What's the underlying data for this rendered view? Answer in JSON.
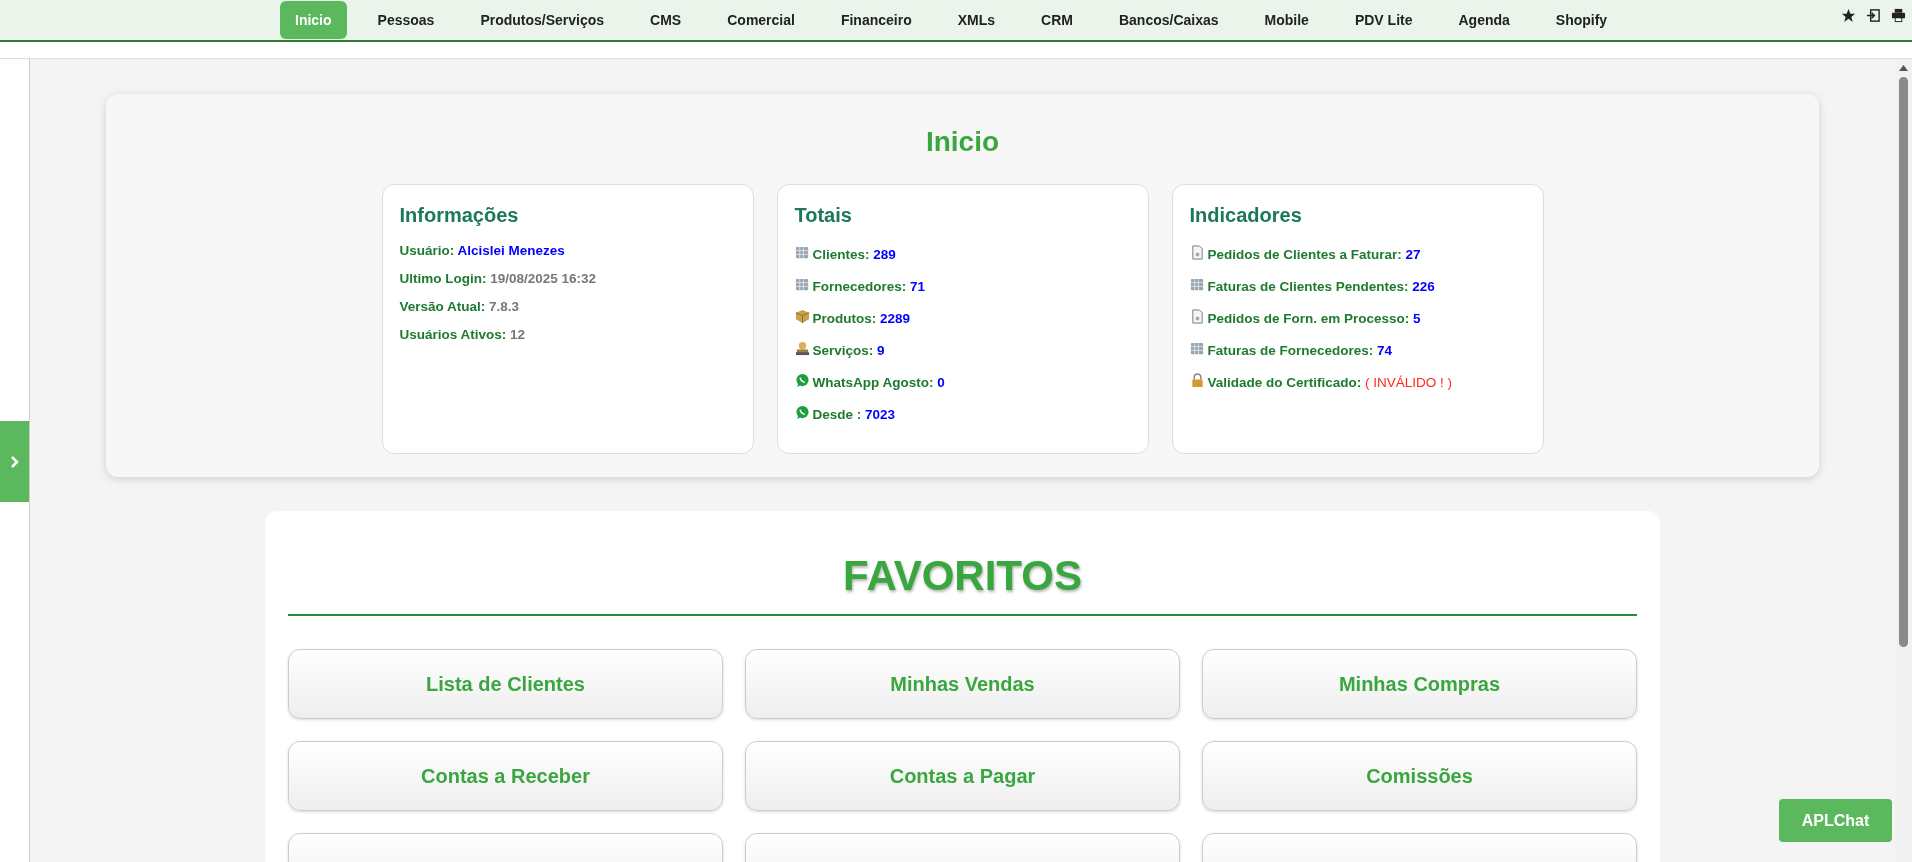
{
  "nav": {
    "items": [
      {
        "label": "Inicio",
        "selected": true
      },
      {
        "label": "Pessoas",
        "selected": false
      },
      {
        "label": "Produtos/Serviços",
        "selected": false
      },
      {
        "label": "CMS",
        "selected": false
      },
      {
        "label": "Comercial",
        "selected": false
      },
      {
        "label": "Financeiro",
        "selected": false
      },
      {
        "label": "XMLs",
        "selected": false
      },
      {
        "label": "CRM",
        "selected": false
      },
      {
        "label": "Bancos/Caixas",
        "selected": false
      },
      {
        "label": "Mobile",
        "selected": false
      },
      {
        "label": "PDV Lite",
        "selected": false
      },
      {
        "label": "Agenda",
        "selected": false
      },
      {
        "label": "Shopify",
        "selected": false
      }
    ],
    "tools": [
      {
        "kind": "star"
      },
      {
        "kind": "logout"
      },
      {
        "kind": "print"
      }
    ]
  },
  "page_title": "Inicio",
  "cards": [
    {
      "title": "Informações",
      "rows": [
        {
          "kind": "user",
          "label": "Usuário:",
          "value": "Alcislei Menezes"
        },
        {
          "kind": "info",
          "label": "Ultimo Login:",
          "value": "19/08/2025 16:32"
        },
        {
          "kind": "info",
          "label": "Versão Atual:",
          "value": "7.8.3"
        },
        {
          "kind": "info",
          "label": "Usuários Ativos:",
          "value": "12"
        }
      ]
    },
    {
      "title": "Totais",
      "rows": [
        {
          "kind": "server",
          "label": "Clientes:",
          "value": "289"
        },
        {
          "kind": "server",
          "label": "Fornecedores:",
          "value": "71"
        },
        {
          "kind": "box",
          "label": "Produtos:",
          "value": "2289"
        },
        {
          "kind": "person",
          "label": "Serviços:",
          "value": "9"
        },
        {
          "kind": "chat",
          "label": "WhatsApp Agosto:",
          "value": "0"
        },
        {
          "kind": "chat",
          "label": "Desde :",
          "value": "7023"
        }
      ]
    },
    {
      "title": "Indicadores",
      "rows": [
        {
          "kind": "document",
          "label": "Pedidos de Clientes a Faturar:",
          "value": "27"
        },
        {
          "kind": "server",
          "label": "Faturas de Clientes Pendentes:",
          "value": "226"
        },
        {
          "kind": "document",
          "label": "Pedidos de Forn. em Processo:",
          "value": "5"
        },
        {
          "kind": "server",
          "label": "Faturas de Fornecedores:",
          "value": "74"
        },
        {
          "kind": "lock",
          "label": "Validade do Certificado:",
          "value": "( INVÁLIDO ! )"
        }
      ]
    }
  ],
  "favorites": {
    "title": "FAVORITOS",
    "items": [
      {
        "kind": "button",
        "label": "Lista de Clientes"
      },
      {
        "kind": "button",
        "label": "Minhas Vendas"
      },
      {
        "kind": "button",
        "label": "Minhas Compras"
      },
      {
        "kind": "button",
        "label": "Contas a Receber"
      },
      {
        "kind": "button",
        "label": "Contas a Pagar"
      },
      {
        "kind": "button",
        "label": "Comissões"
      },
      {
        "kind": "cut"
      },
      {
        "kind": "cut"
      },
      {
        "kind": "cut"
      }
    ]
  },
  "chat_button": "APLChat"
}
